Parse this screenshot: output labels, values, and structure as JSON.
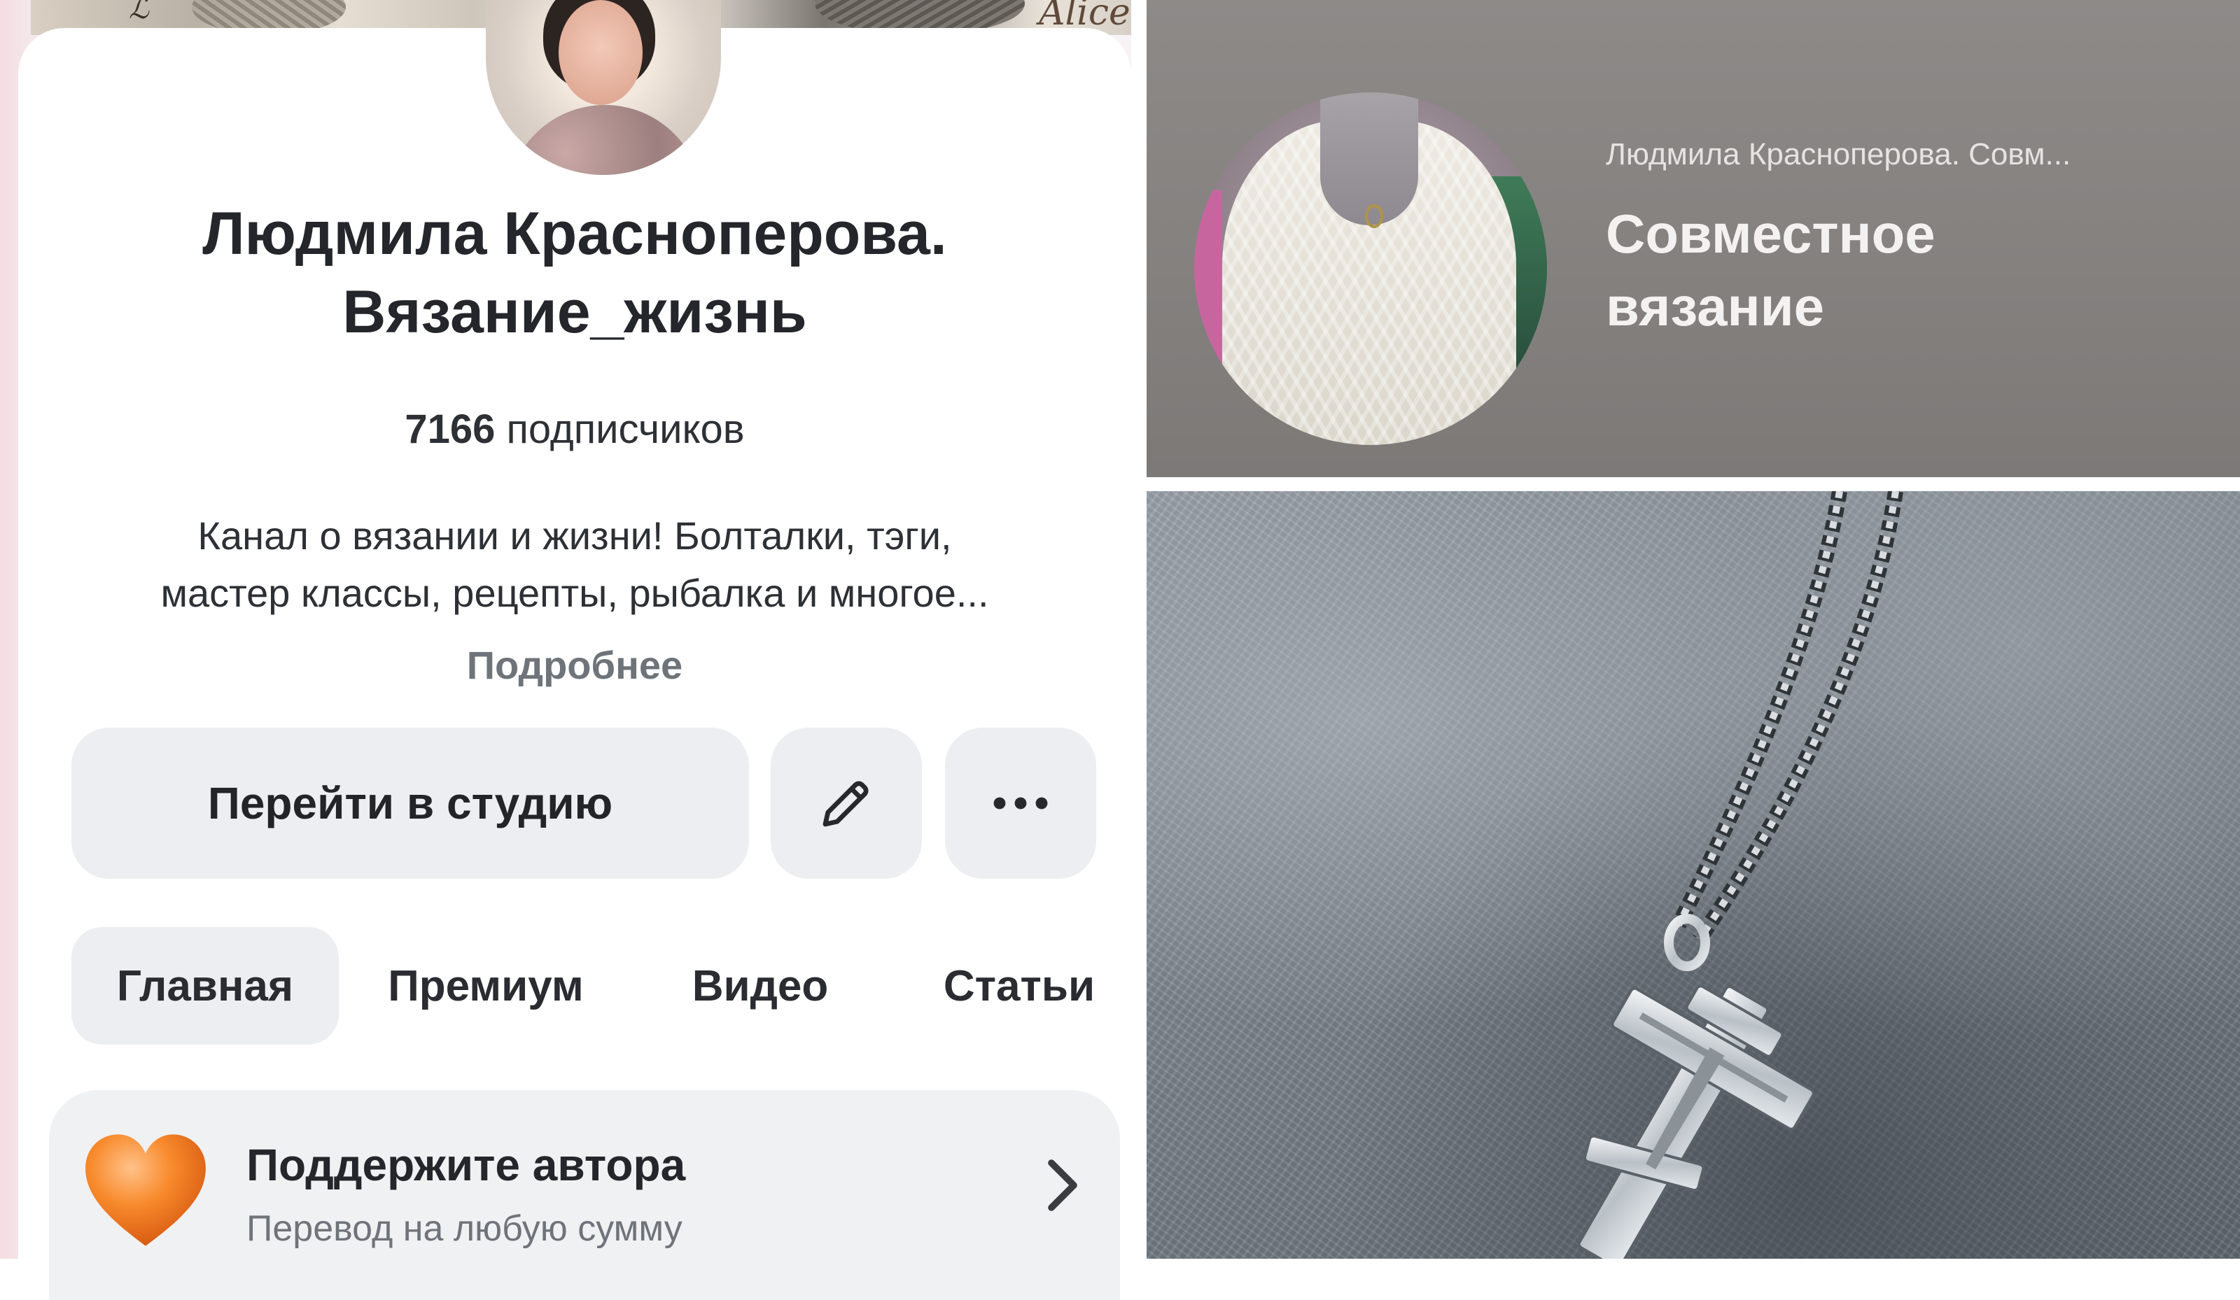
{
  "profile": {
    "name_line1": "Людмила Красноперова.",
    "name_line2": "Вязание_жизнь",
    "subscribers_count": "7166",
    "subscribers_label": "подписчиков",
    "description_line1": "Канал о вязании и жизни! Болталки, тэги,",
    "description_line2": "мастер классы, рецепты, рыбалка и многое...",
    "more_link": "Подробнее"
  },
  "cover": {
    "logo_text": "Alice"
  },
  "actions": {
    "studio_button": "Перейти в студию",
    "edit_icon": "pencil-icon",
    "more_icon": "more-dots-icon"
  },
  "tabs": [
    {
      "label": "Главная",
      "active": true
    },
    {
      "label": "Премиум",
      "active": false
    },
    {
      "label": "Видео",
      "active": false
    },
    {
      "label": "Статьи",
      "active": false
    }
  ],
  "support": {
    "title": "Поддержите автора",
    "subtitle": "Перевод на любую сумму",
    "icon": "heart-icon",
    "chevron": "chevron-right-icon"
  },
  "video_card": {
    "channel": "Людмила Красноперова. Совм...",
    "title_line1": "Совместное",
    "title_line2": "вязание"
  },
  "colors": {
    "accent_heart": "#f47a1f",
    "button_bg": "#edeef1",
    "text_primary": "#24262b",
    "text_secondary": "#6f737a",
    "video_card_bg": "#858280"
  }
}
